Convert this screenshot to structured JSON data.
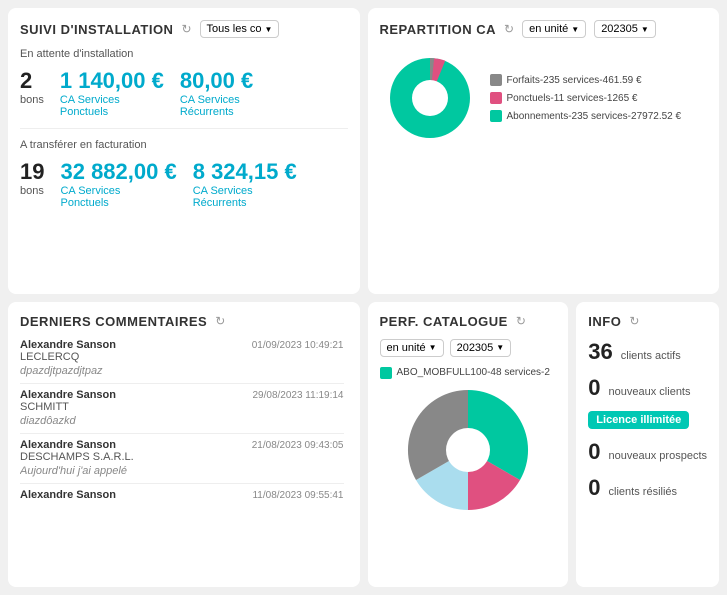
{
  "suivi": {
    "title": "SUIVI D'INSTALLATION",
    "filter": "Tous les co",
    "section1": {
      "label": "En attente d'installation",
      "count": "2",
      "count_label": "bons",
      "ca_ponctuel": "1 140,00 €",
      "ca_ponctuel_label1": "CA Services",
      "ca_ponctuel_label2": "Ponctuels",
      "ca_recurrent": "80,00 €",
      "ca_recurrent_label1": "CA Services",
      "ca_recurrent_label2": "Récurrents"
    },
    "section2": {
      "label": "A transférer en facturation",
      "count": "19",
      "count_label": "bons",
      "ca_ponctuel": "32 882,00 €",
      "ca_ponctuel_label1": "CA Services",
      "ca_ponctuel_label2": "Ponctuels",
      "ca_recurrent": "8 324,15 €",
      "ca_recurrent_label1": "CA Services",
      "ca_recurrent_label2": "Récurrents"
    }
  },
  "repartition": {
    "title": "REPARTITION CA",
    "filter_unite": "en unité",
    "filter_date": "202305",
    "legend": [
      {
        "color": "#888888",
        "label": "Forfaits-235 services-461.59 €"
      },
      {
        "color": "#e05080",
        "label": "Ponctuels-11 services-1265 €"
      },
      {
        "color": "#00c8a0",
        "label": "Abonnements-235 services-27972.52 €"
      }
    ],
    "pie": {
      "forfaits_pct": 1.6,
      "ponctuels_pct": 4.2,
      "abonnements_pct": 94.2
    }
  },
  "commentaires": {
    "title": "DERNIERS COMMENTAIRES",
    "items": [
      {
        "author": "Alexandre Sanson",
        "company": "LECLERCQ",
        "date": "01/09/2023 10:49:21",
        "text": "dpazdjtpazdjtpaz"
      },
      {
        "author": "Alexandre Sanson",
        "company": "SCHMITT",
        "date": "29/08/2023 11:19:14",
        "text": "diazdôazkd"
      },
      {
        "author": "Alexandre Sanson",
        "company": "DESCHAMPS S.A.R.L.",
        "date": "21/08/2023 09:43:05",
        "text": "Aujourd'hui j'ai appelé"
      },
      {
        "author": "Alexandre Sanson",
        "company": "",
        "date": "11/08/2023 09:55:41",
        "text": ""
      }
    ]
  },
  "perf": {
    "title": "PERF. CATALOGUE",
    "filter_unite": "en unité",
    "filter_date": "202305",
    "legend_label": "ABO_MOBFULL100-48 services-2",
    "legend_color": "#00c8a0"
  },
  "info": {
    "title": "INFO",
    "clients_actifs_count": "36",
    "clients_actifs_label": "clients actifs",
    "nouveaux_clients_count": "0",
    "nouveaux_clients_label": "nouveaux clients",
    "badge": "Licence illimitée",
    "nouveaux_prospects_count": "0",
    "nouveaux_prospects_label": "nouveaux prospects",
    "clients_resilies_count": "0",
    "clients_resilies_label": "clients résiliés"
  }
}
